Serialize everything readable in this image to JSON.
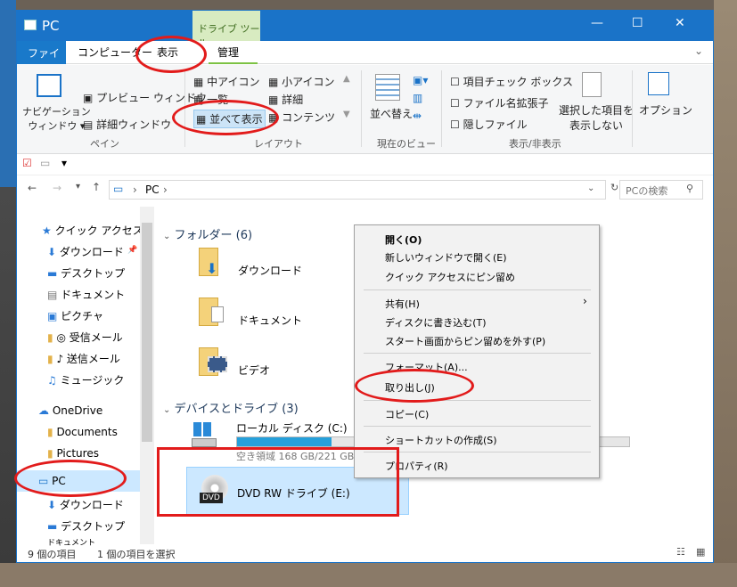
{
  "window": {
    "title": "PC",
    "context_tab": "ドライブ ツール",
    "min": "—",
    "max": "☐",
    "close": "✕"
  },
  "tabs": {
    "file": "ファイル",
    "computer": "コンピューター",
    "view": "表示",
    "manage": "管理"
  },
  "ribbon": {
    "nav_pane": "ナビゲーション\nウィンドウ ▾",
    "preview_pane": "プレビュー ウィンドウ",
    "details_pane": "詳細ウィンドウ",
    "panes_group": "ペイン",
    "medium_icons": "中アイコン",
    "small_icons": "小アイコン",
    "list": "一覧",
    "details": "詳細",
    "tiles": "並べて表示",
    "content": "コンテンツ",
    "layout_group": "レイアウト",
    "sort": "並べ替え",
    "current_view_group": "現在のビュー",
    "item_checkboxes": "項目チェック ボックス",
    "file_extensions": "ファイル名拡張子",
    "hidden_items": "隠しファイル",
    "hide_selected": "選択した項目を\n表示しない",
    "options": "オプション",
    "showhide_group": "表示/非表示"
  },
  "nav": {
    "address": "PC",
    "search_placeholder": "PCの検索"
  },
  "sidebar": {
    "quick_access": "クイック アクセス",
    "items": [
      "ダウンロード",
      "デスクトップ",
      "ドキュメント",
      "ピクチャ",
      "◎ 受信メール",
      "♪ 送信メール",
      "ミュージック"
    ],
    "onedrive": "OneDrive",
    "od_items": [
      "Documents",
      "Pictures"
    ],
    "pc": "PC",
    "pc_items": [
      "ダウンロード",
      "デスクトップ",
      "ドキュメント"
    ]
  },
  "content": {
    "folders_header": "フォルダー (6)",
    "folders": [
      "ダウンロード",
      "ドキュメント",
      "ビデオ"
    ],
    "devices_header": "デバイスとドライブ (3)",
    "local_disk": "ローカル ディスク (C:)",
    "local_disk_free": "空き領域 168 GB/221 GB",
    "local_disk_used_fraction": 0.24,
    "dvd": "DVD RW ドライブ (E:)",
    "dvd_badge": "DVD"
  },
  "context_menu": {
    "open": "開く(O)",
    "open_new": "新しいウィンドウで開く(E)",
    "pin_quick": "クイック アクセスにピン留め",
    "share": "共有(H)",
    "burn": "ディスクに書き込む(T)",
    "unpin_start": "スタート画面からピン留めを外す(P)",
    "format": "フォーマット(A)...",
    "eject": "取り出し(J)",
    "copy": "コピー(C)",
    "shortcut": "ショートカットの作成(S)",
    "properties": "プロパティ(R)"
  },
  "status": {
    "count": "9 個の項目",
    "selected": "1 個の項目を選択"
  },
  "colors": {
    "accent": "#1a73c8",
    "annotation": "#e21b1b",
    "context_tab": "#d8ebc1"
  }
}
